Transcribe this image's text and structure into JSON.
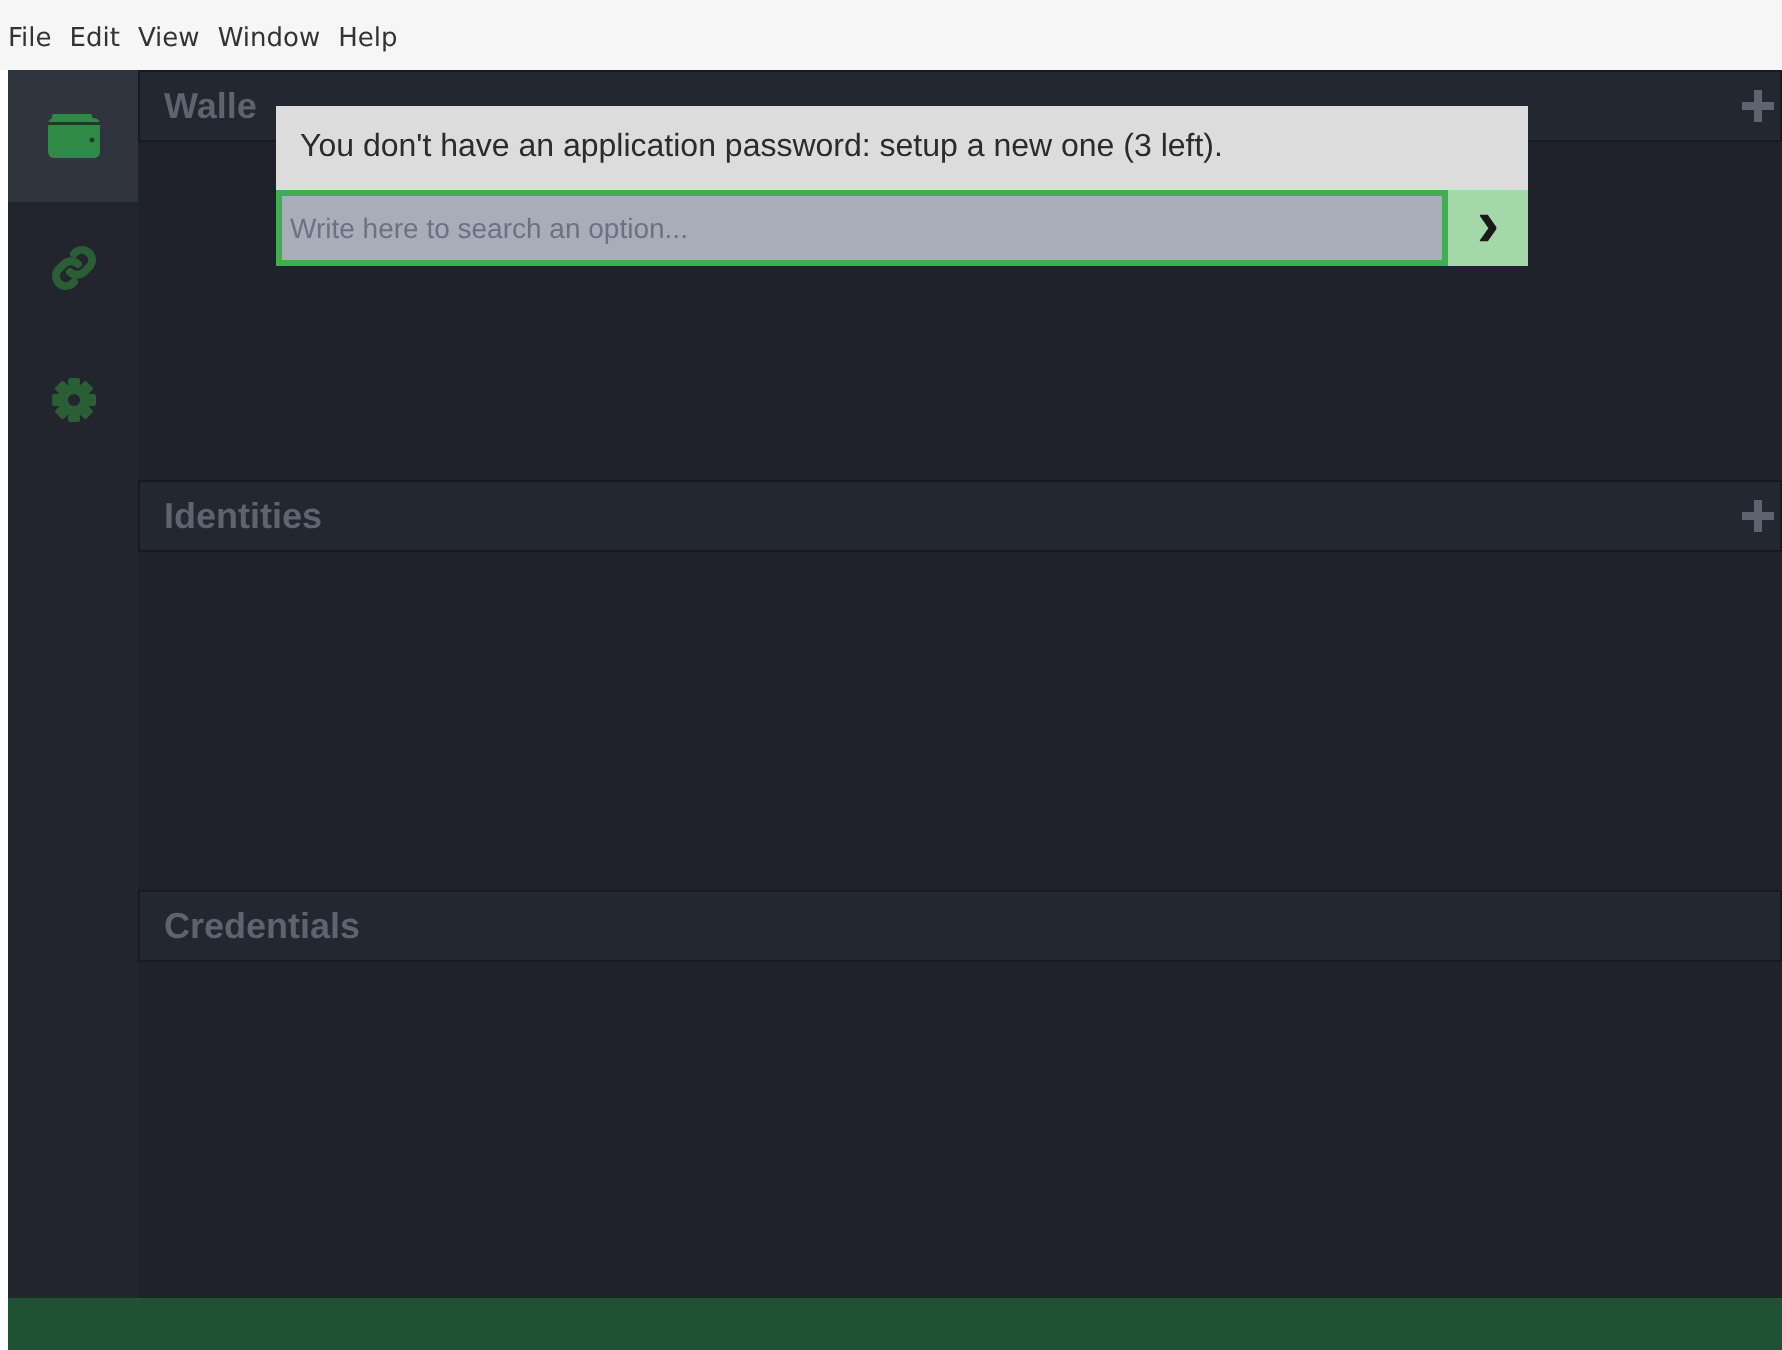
{
  "menu": [
    "File",
    "Edit",
    "View",
    "Window",
    "Help"
  ],
  "sidebar": {
    "items": [
      {
        "kind": "wallet",
        "selected": true
      },
      {
        "kind": "link",
        "selected": false
      },
      {
        "kind": "settings",
        "selected": false
      }
    ]
  },
  "sections": [
    {
      "title": "Walle",
      "add_button": true
    },
    {
      "title": "Identities",
      "add_button": true
    },
    {
      "title": "Credentials",
      "add_button": false
    }
  ],
  "prompt": {
    "message": "You don't have an application password: setup a new one (3 left).",
    "placeholder": "Write here to search an option...",
    "submit": "›"
  }
}
